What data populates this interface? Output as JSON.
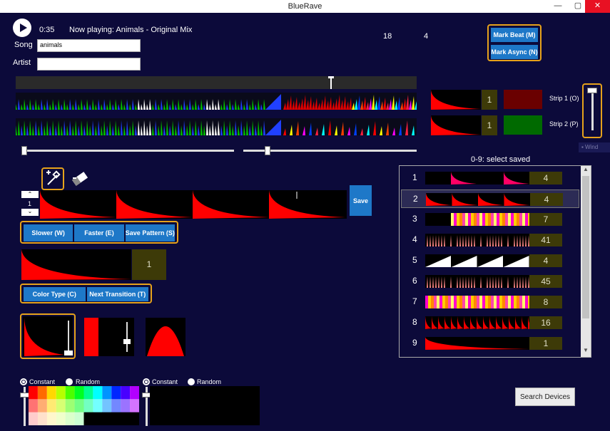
{
  "window": {
    "title": "BlueRave",
    "minimize": "—",
    "maximize": "▢",
    "close": "✕"
  },
  "player": {
    "time": "0:35",
    "now_playing": "Now playing: Animals - Original Mix",
    "counter_a": "18",
    "counter_b": "4"
  },
  "song": {
    "label": "Song",
    "value": "animals"
  },
  "artist": {
    "label": "Artist",
    "value": ""
  },
  "buttons": {
    "mark_beat": "Mark Beat (M)",
    "mark_async": "Mark Async (N)",
    "save": "Save",
    "slower": "Slower (W)",
    "faster": "Faster (E)",
    "save_pattern": "Save Pattern (S)",
    "color_type": "Color Type (C)",
    "next_transition": "Next Transition (T)",
    "search_devices": "Search Devices"
  },
  "strips": [
    {
      "label": "Strip 1 (O)",
      "count": "1",
      "color": "#6a0000"
    },
    {
      "label": "Strip 2 (P)",
      "count": "1",
      "color": "#006a00"
    }
  ],
  "pattern_stepper": {
    "value": "1"
  },
  "current_pattern": {
    "count": "1"
  },
  "saved": {
    "header": "0-9: select saved",
    "items": [
      {
        "num": "1",
        "count": "4",
        "type": "sparse"
      },
      {
        "num": "2",
        "count": "4",
        "type": "decay"
      },
      {
        "num": "3",
        "count": "7",
        "type": "rainbow"
      },
      {
        "num": "4",
        "count": "41",
        "type": "spikes"
      },
      {
        "num": "5",
        "count": "4",
        "type": "white-saw"
      },
      {
        "num": "6",
        "count": "45",
        "type": "spikes"
      },
      {
        "num": "7",
        "count": "8",
        "type": "rainbow-full"
      },
      {
        "num": "8",
        "count": "16",
        "type": "red-spikes"
      },
      {
        "num": "9",
        "count": "1",
        "type": "single"
      }
    ]
  },
  "color_left": {
    "constant": "Constant",
    "random": "Random"
  },
  "color_right": {
    "constant": "Constant",
    "random": "Random"
  },
  "hidden_tab": "▪ Wind",
  "accent": "#e6a21b",
  "button_color": "#1e78c8"
}
